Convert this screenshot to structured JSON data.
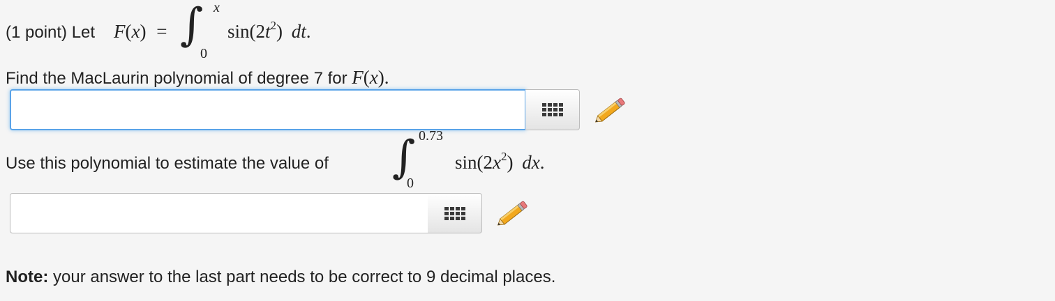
{
  "problem": {
    "intro": "(1 point) Let",
    "func_name": "F",
    "func_var": "x",
    "equals": "=",
    "integral_upper": "x",
    "integral_lower": "0",
    "integrand_func": "sin(2",
    "integrand_var": "t",
    "integrand_exp": "2",
    "integrand_close": ")",
    "differential": "dt",
    "period": "."
  },
  "part1": {
    "prompt": "Find the MacLaurin polynomial of degree 7 for",
    "func": "F",
    "paren_open": "(",
    "var": "x",
    "paren_close": ").",
    "answer_value": ""
  },
  "part2": {
    "prompt": "Use this polynomial to estimate the value of",
    "integral_upper": "0.73",
    "integral_lower": "0",
    "integrand_func": "sin(2",
    "integrand_var": "x",
    "integrand_exp": "2",
    "integrand_close": ")",
    "differential": "dx",
    "period": ".",
    "answer_value": ""
  },
  "note": {
    "label": "Note:",
    "text": "your answer to the last part needs to be correct to 9 decimal places."
  },
  "icons": {
    "palette": "equation-palette-icon",
    "pencil": "pencil-icon"
  },
  "colors": {
    "focus_border": "#5aa3e8",
    "background": "#f5f5f5"
  }
}
